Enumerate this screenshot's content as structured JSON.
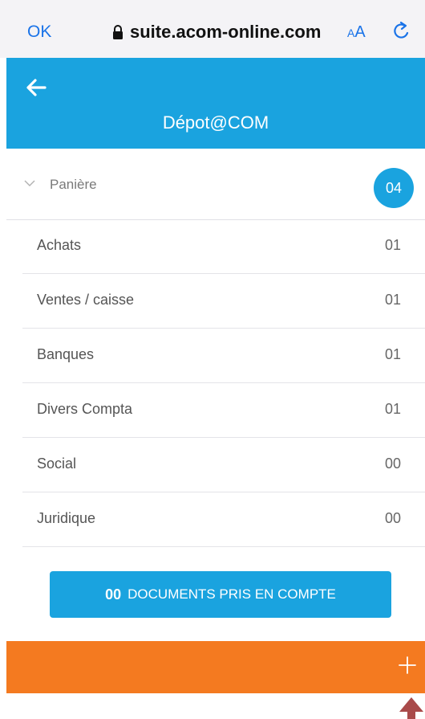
{
  "browser": {
    "ok_label": "OK",
    "url": "suite.acom-online.com",
    "text_size_label_small": "A",
    "text_size_label_big": "A"
  },
  "header": {
    "title": "Dépot@COM"
  },
  "group": {
    "label": "Panière",
    "count": "04"
  },
  "categories": [
    {
      "label": "Achats",
      "count": "01"
    },
    {
      "label": "Ventes / caisse",
      "count": "01"
    },
    {
      "label": "Banques",
      "count": "01"
    },
    {
      "label": "Divers Compta",
      "count": "01"
    },
    {
      "label": "Social",
      "count": "00"
    },
    {
      "label": "Juridique",
      "count": "00"
    }
  ],
  "documents_button": {
    "count": "00",
    "label": "DOCUMENTS PRIS EN COMPTE"
  },
  "colors": {
    "accent": "#1aa3df",
    "bottom_bar": "#f47a20",
    "arrow": "#a94a4a"
  },
  "icons": [
    "lock-icon",
    "reload-icon",
    "back-arrow-icon",
    "chevron-down-icon",
    "plus-icon",
    "up-arrow-icon"
  ]
}
